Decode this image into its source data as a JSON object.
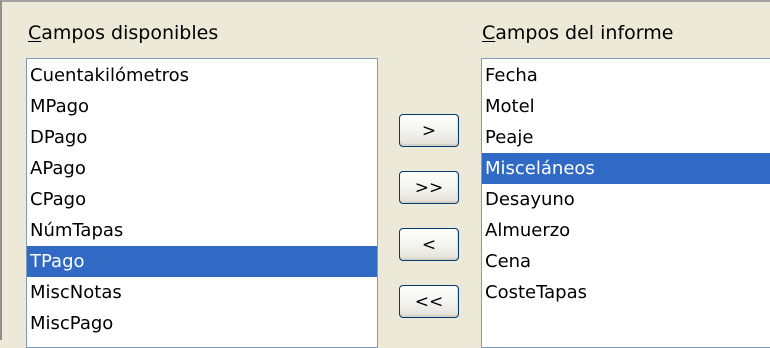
{
  "available_fields": {
    "label_mnemonic": "C",
    "label_rest": "ampos disponibles",
    "items": [
      {
        "label": "Cuentakilómetros",
        "selected": false
      },
      {
        "label": "MPago",
        "selected": false
      },
      {
        "label": "DPago",
        "selected": false
      },
      {
        "label": "APago",
        "selected": false
      },
      {
        "label": "CPago",
        "selected": false
      },
      {
        "label": "NúmTapas",
        "selected": false
      },
      {
        "label": "TPago",
        "selected": true
      },
      {
        "label": "MiscNotas",
        "selected": false
      },
      {
        "label": "MiscPago",
        "selected": false
      }
    ]
  },
  "report_fields": {
    "label_mnemonic": "C",
    "label_rest": "ampos del informe",
    "items": [
      {
        "label": "Fecha",
        "selected": false
      },
      {
        "label": "Motel",
        "selected": false
      },
      {
        "label": "Peaje",
        "selected": false
      },
      {
        "label": "Misceláneos",
        "selected": true
      },
      {
        "label": "Desayuno",
        "selected": false
      },
      {
        "label": "Almuerzo",
        "selected": false
      },
      {
        "label": "Cena",
        "selected": false
      },
      {
        "label": "CosteTapas",
        "selected": false
      }
    ]
  },
  "buttons": {
    "move_one_right": ">",
    "move_all_right": ">>",
    "move_one_left": "<",
    "move_all_left": "<<"
  },
  "colors": {
    "selection": "#316ac5",
    "dialog_background": "#ece9d8",
    "list_border": "#7f9db9"
  }
}
